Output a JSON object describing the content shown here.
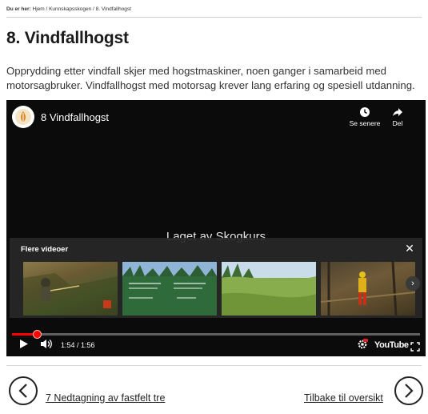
{
  "breadcrumb": {
    "prefix": "Du er her:",
    "path": "Hjem / Kunnskapsskogen / 8. Vindfallhogst"
  },
  "page": {
    "title": "8. Vindfallhogst",
    "intro": "Opprydding etter vindfall skjer med hogstmaskiner, noen ganger i samarbeid med motorsagbruker. Vindfallhogst med motorsag krever lang erfaring og spesiell utdanning."
  },
  "video": {
    "title": "8 Vindfallhogst",
    "watch_later_label": "Se senere",
    "share_label": "Del",
    "watermark": "Laget av Skogkurs",
    "more_videos_title": "Flere videoer",
    "time_display": "1:54 / 1:56",
    "progress_fraction": 0.06,
    "youtube_label": "YouTube",
    "thumbnails": [
      {
        "id": "t1"
      },
      {
        "id": "t2"
      },
      {
        "id": "t3"
      },
      {
        "id": "t4"
      }
    ]
  },
  "navigation": {
    "prev_label": "7 Nedtagning av fastfelt tre",
    "next_label": "Tilbake til oversikt"
  },
  "colors": {
    "progress": "#ff0000",
    "video_bg": "#0b0b0b"
  },
  "icons": {
    "channel": "leaf-logo-icon",
    "watch_later": "clock-icon",
    "share": "share-arrow-icon",
    "close": "close-icon",
    "next": "chevron-right-icon",
    "play": "play-icon",
    "volume": "volume-icon",
    "settings": "gear-icon",
    "fullscreen": "fullscreen-icon",
    "prev_page": "chevron-left-circle-icon",
    "next_page": "chevron-right-circle-icon"
  }
}
